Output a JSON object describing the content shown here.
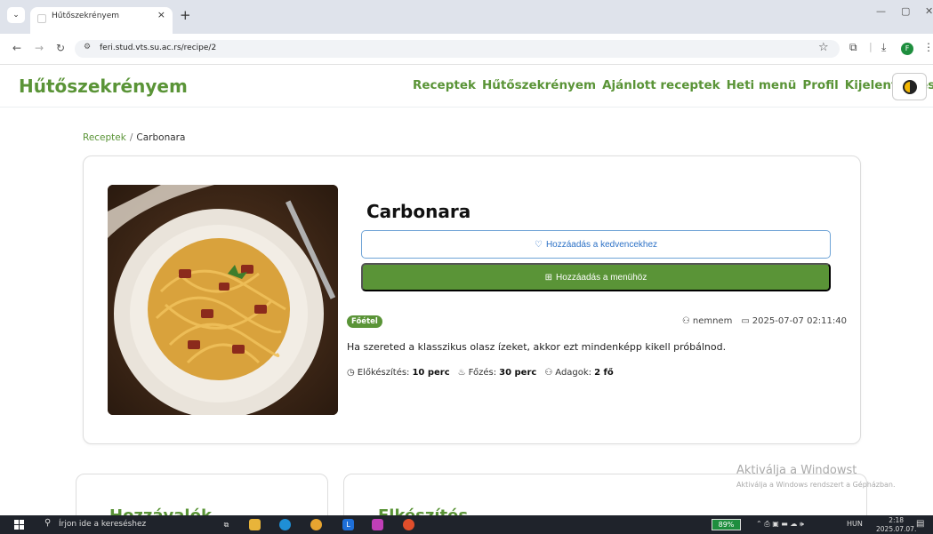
{
  "browser": {
    "tab_title": "Hűtőszekrényem",
    "tab_close": "×",
    "new_tab": "+",
    "url": "feri.stud.vts.su.ac.rs/recipe/2",
    "profile_initial": "F"
  },
  "site": {
    "brand": "Hűtőszekrényem",
    "nav": [
      "Receptek",
      "Hűtőszekrényem",
      "Ajánlott receptek",
      "Heti menü",
      "Profil",
      "Kijelentkezés"
    ]
  },
  "breadcrumb": {
    "parent": "Receptek",
    "separator": "/",
    "current": "Carbonara"
  },
  "recipe": {
    "title": "Carbonara",
    "favorite_label": "Hozzáadás a kedvencekhez",
    "menu_label": "Hozzáadás a menühöz",
    "category": "Főétel",
    "author": "nemnem",
    "datetime": "2025-07-07 02:11:40",
    "description": "Ha szereted a klasszikus olasz ízeket, akkor ezt mindenképp kikell próbálnod.",
    "prep_label": "Előkészítés:",
    "prep_value": "10 perc",
    "cook_label": "Főzés:",
    "cook_value": "30 perc",
    "servings_label": "Adagok:",
    "servings_value": "2 fő"
  },
  "sections": {
    "ingredients": "Hozzávalók",
    "preparation": "Elkészítés"
  },
  "watermark": {
    "line1": "Aktiválja a Windowst",
    "line2": "Aktiválja a Windows rendszert a Gépházban."
  },
  "taskbar": {
    "search_placeholder": "Írjon ide a kereséshez",
    "battery": "89%",
    "language": "HUN",
    "time": "2:18",
    "date": "2025.07.07."
  },
  "icons": {
    "back": "arrow-left-icon",
    "forward": "arrow-right-icon",
    "reload": "reload-icon",
    "bookmark": "star-icon",
    "extensions": "puzzle-icon",
    "download": "download-icon",
    "theme": "half-moon-icon",
    "favorite": "heart-icon",
    "add_menu": "calendar-plus-icon",
    "author": "user-icon",
    "date": "calendar-icon",
    "prep": "clock-icon",
    "cook": "flame-icon",
    "servings": "people-icon"
  },
  "colors": {
    "brand": "#5a9437",
    "link_blue": "#2c71c6",
    "taskbar": "#1f232b"
  }
}
